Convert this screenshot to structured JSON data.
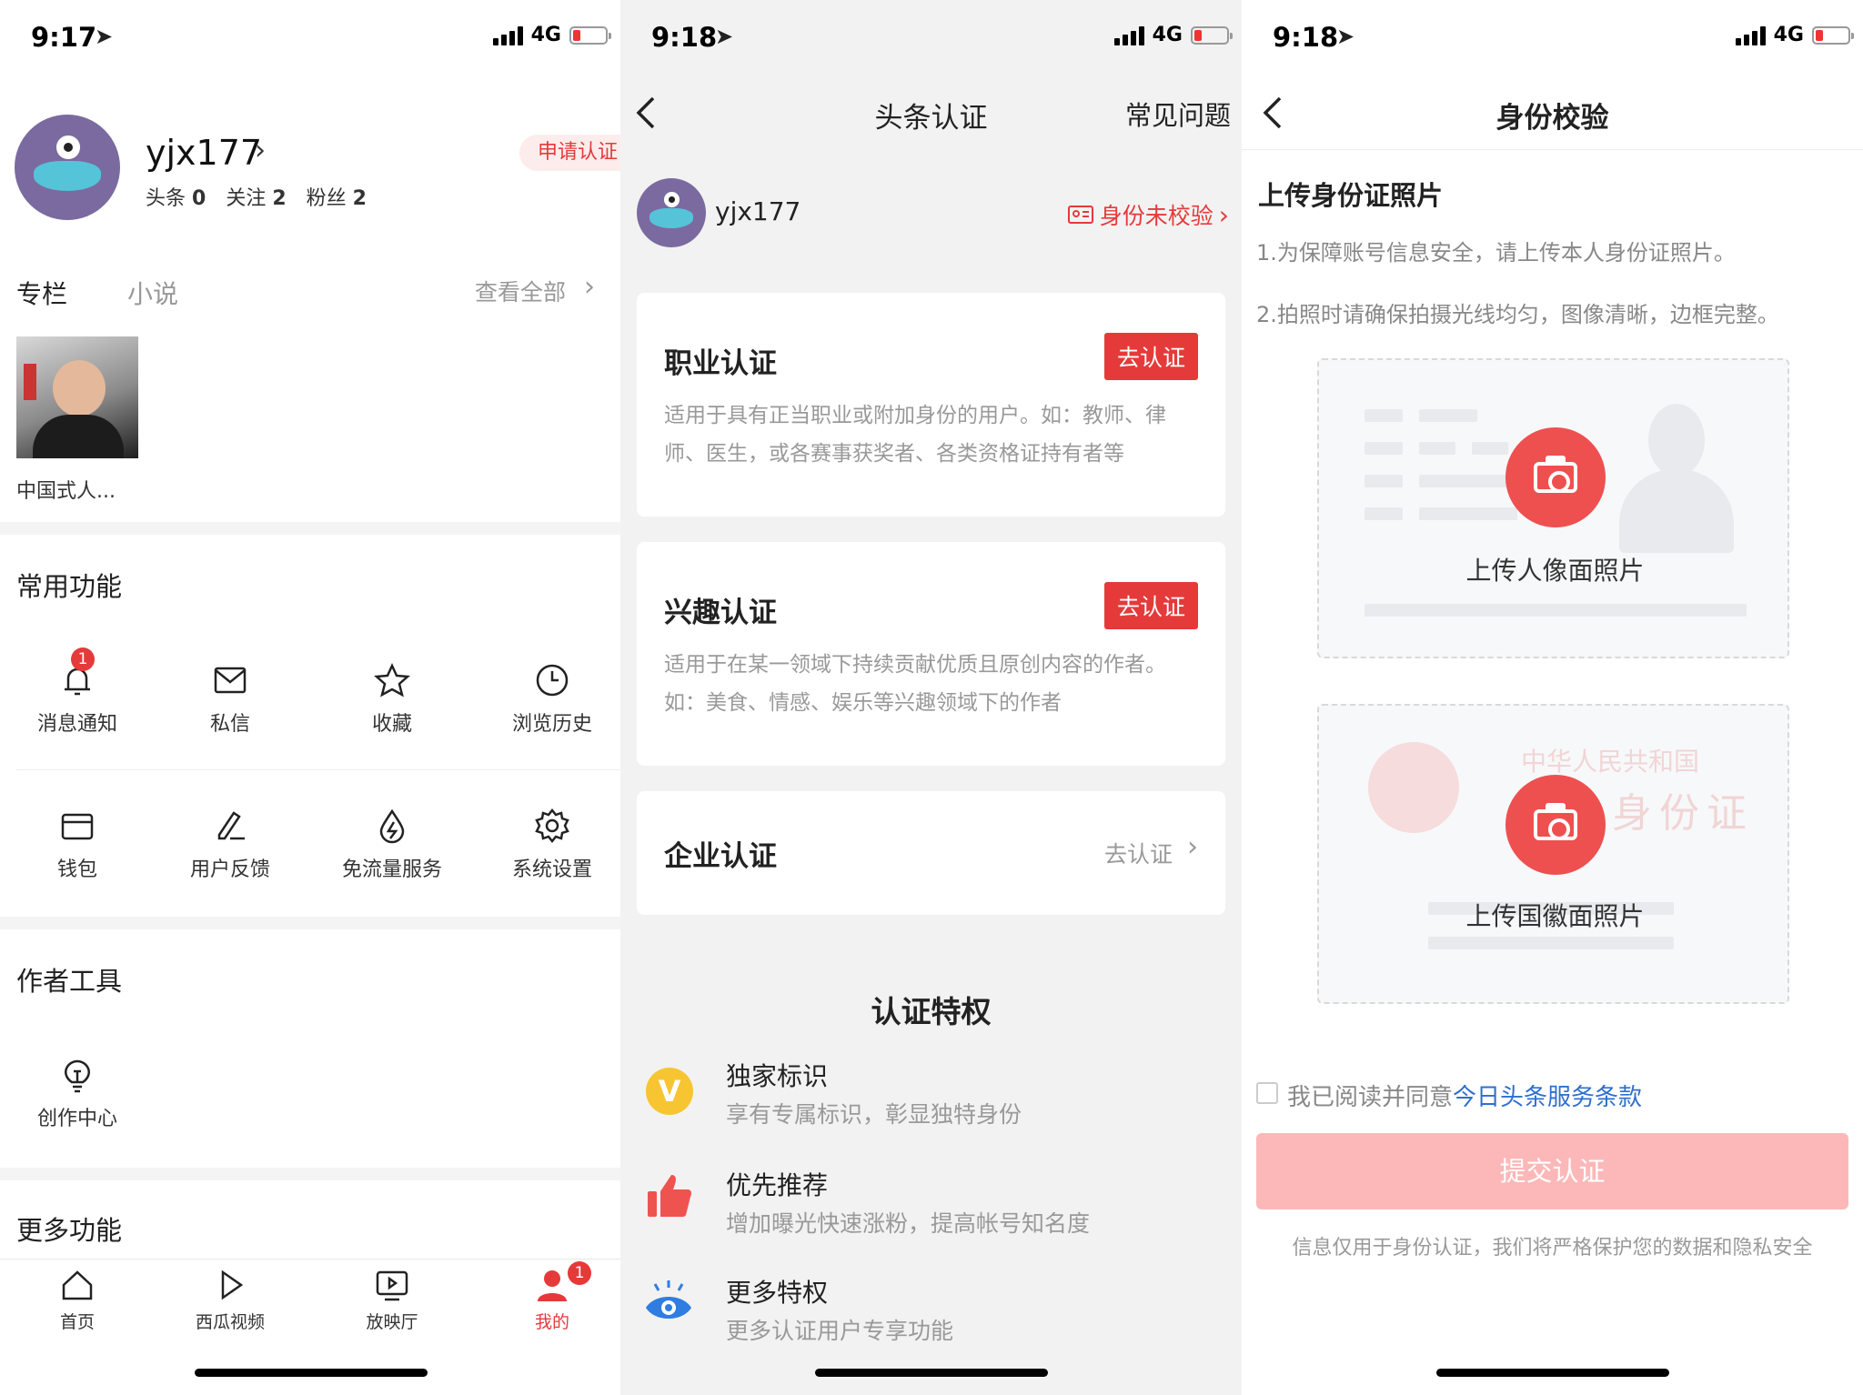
{
  "screen1": {
    "status": {
      "time": "9:17",
      "network": "4G"
    },
    "profile": {
      "username": "yjx177",
      "stats": [
        {
          "label": "头条",
          "value": "0"
        },
        {
          "label": "关注",
          "value": "2"
        },
        {
          "label": "粉丝",
          "value": "2"
        }
      ],
      "apply_badge": "申请认证"
    },
    "tabs": {
      "column": "专栏",
      "novel": "小说",
      "view_all": "查看全部"
    },
    "column_item": {
      "title": "中国式人..."
    },
    "common_title": "常用功能",
    "functions": [
      {
        "label": "消息通知",
        "badge": "1"
      },
      {
        "label": "私信"
      },
      {
        "label": "收藏"
      },
      {
        "label": "浏览历史"
      },
      {
        "label": "钱包"
      },
      {
        "label": "用户反馈"
      },
      {
        "label": "免流量服务"
      },
      {
        "label": "系统设置"
      }
    ],
    "author_title": "作者工具",
    "author_tools": [
      {
        "label": "创作中心"
      }
    ],
    "more_title": "更多功能",
    "tabbar": [
      {
        "label": "首页"
      },
      {
        "label": "西瓜视频"
      },
      {
        "label": "放映厅"
      },
      {
        "label": "我的",
        "badge": "1"
      }
    ],
    "accent": "#e53a3a"
  },
  "screen2": {
    "status": {
      "time": "9:18",
      "network": "4G"
    },
    "title": "头条认证",
    "faq": "常见问题",
    "username": "yjx177",
    "id_status": "身份未校验",
    "cards": [
      {
        "title": "职业认证",
        "button": "去认证",
        "desc": "适用于具有正当职业或附加身份的用户。如：教师、律师、医生，或各赛事获奖者、各类资格证持有者等"
      },
      {
        "title": "兴趣认证",
        "button": "去认证",
        "desc": "适用于在某一领域下持续贡献优质且原创内容的作者。如：美食、情感、娱乐等兴趣领域下的作者"
      },
      {
        "title": "企业认证",
        "link": "去认证"
      }
    ],
    "privileges_title": "认证特权",
    "privileges": [
      {
        "title": "独家标识",
        "desc": "享有专属标识，彰显独特身份",
        "icon": "v-badge-icon",
        "color": "#f7c531"
      },
      {
        "title": "优先推荐",
        "desc": "增加曝光快速涨粉，提高帐号知名度",
        "icon": "thumbs-up-icon",
        "color": "#ef5350"
      },
      {
        "title": "更多特权",
        "desc": "更多认证用户专享功能",
        "icon": "eye-icon",
        "color": "#2f7de1"
      }
    ]
  },
  "screen3": {
    "status": {
      "time": "9:18",
      "network": "4G"
    },
    "title": "身份校验",
    "section_title": "上传身份证照片",
    "tips": [
      "1.为保障账号信息安全，请上传本人身份证照片。",
      "2.拍照时请确保拍摄光线均匀，图像清晰，边框完整。"
    ],
    "upload_front": "上传人像面照片",
    "upload_back": "上传国徽面照片",
    "card_watermark_1": "中华人民共和国",
    "card_watermark_2": "身份证",
    "agree_prefix": "我已阅读并同意",
    "agree_link": "今日头条服务条款",
    "submit": "提交认证",
    "footer": "信息仅用于身份认证，我们将严格保护您的数据和隐私安全",
    "link_color": "#2f6fce"
  }
}
